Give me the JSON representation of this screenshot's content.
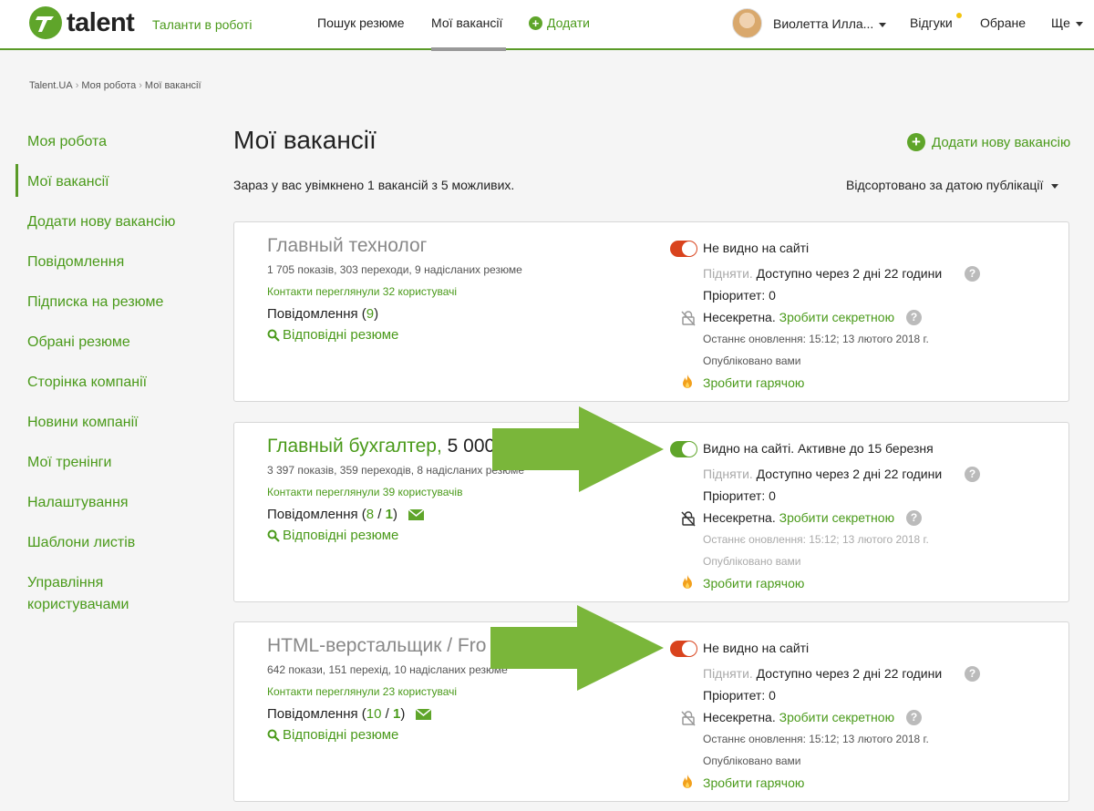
{
  "header": {
    "logo_text": "talent",
    "tagline": "Таланти в роботі",
    "nav": {
      "search": "Пошук резюме",
      "my_vacancies": "Мої вакансії",
      "add": "Додати"
    },
    "user_name": "Виолетта Илла...",
    "responses": "Відгуки",
    "favorites": "Обране",
    "more": "Ще"
  },
  "breadcrumb": [
    "Talent.UA",
    "Моя робота",
    "Мої вакансії"
  ],
  "sidebar": {
    "items": [
      "Моя робота",
      "Мої вакансії",
      "Додати нову вакансію",
      "Повідомлення",
      "Підписка на резюме",
      "Обрані резюме",
      "Сторінка компанії",
      "Новини компанії",
      "Мої тренінги",
      "Налаштування",
      "Шаблони листів",
      "Управління\nкористувачами"
    ]
  },
  "main": {
    "title": "Мої вакансії",
    "add_new": "Додати нову вакансію",
    "info": "Зараз у вас увімкнено 1 вакансій з 5 можливих.",
    "sort": "Відсортовано за датою публікації"
  },
  "cards": [
    {
      "title": "Главный технолог",
      "salary": "",
      "stats": "1 705 показів, 303 переходи, 9 надісланих резюме",
      "contacts": "Контакти переглянули 32 користувачі",
      "messages_label": "Повідомлення (",
      "messages_count": "9",
      "messages_new": "",
      "messages_close": ")",
      "resumes": "Відповідні резюме",
      "visibility": "Не видно на сайті",
      "raise_label": "Підняти.",
      "raise_text": "Доступно через 2 дні 22 години",
      "priority": "Пріоритет: 0",
      "secret_label": "Несекретна.",
      "secret_link": "Зробити секретною",
      "updated": "Останнє оновлення: 15:12; 13 лютого 2018 г.",
      "published": "Опубліковано вами",
      "hot": "Зробити гарячою"
    },
    {
      "title": "Главный бухгалтер,",
      "salary": " 5 000",
      "stats": "3 397 показів, 359 переходів, 8 надісланих резюме",
      "contacts": "Контакти переглянули 39 користувачів",
      "messages_label": "Повідомлення (",
      "messages_count": "8",
      "messages_new": "1",
      "messages_close": ")",
      "resumes": "Відповідні резюме",
      "visibility": "Видно на сайті. Активне до 15 березня",
      "raise_label": "Підняти.",
      "raise_text": "Доступно через 2 дні 22 години",
      "priority": "Пріоритет: 0",
      "secret_label": "Несекретна.",
      "secret_link": "Зробити секретною",
      "updated": "Останнє оновлення: 15:12; 13 лютого 2018 г.",
      "published": "Опубліковано вами",
      "hot": "Зробити гарячою"
    },
    {
      "title": "HTML-верстальщик / Fro",
      "salary": "",
      "stats": "642 покази, 151 перехід, 10 надісланих резюме",
      "contacts": "Контакти переглянули 23 користувачі",
      "messages_label": "Повідомлення (",
      "messages_count": "10",
      "messages_new": "1",
      "messages_close": ")",
      "resumes": "Відповідні резюме",
      "visibility": "Не видно на сайті",
      "raise_label": "Підняти.",
      "raise_text": "Доступно через 2 дні 22 години",
      "priority": "Пріоритет: 0",
      "secret_label": "Несекретна.",
      "secret_link": "Зробити секретною",
      "updated": "Останнє оновлення: 15:12; 13 лютого 2018 г.",
      "published": "Опубліковано вами",
      "hot": "Зробити гарячою"
    }
  ],
  "colors": {
    "brand_green": "#5fa52a",
    "link_green": "#4a9a1a",
    "toggle_off": "#d9431d",
    "arrow_green": "#7ab63a"
  }
}
